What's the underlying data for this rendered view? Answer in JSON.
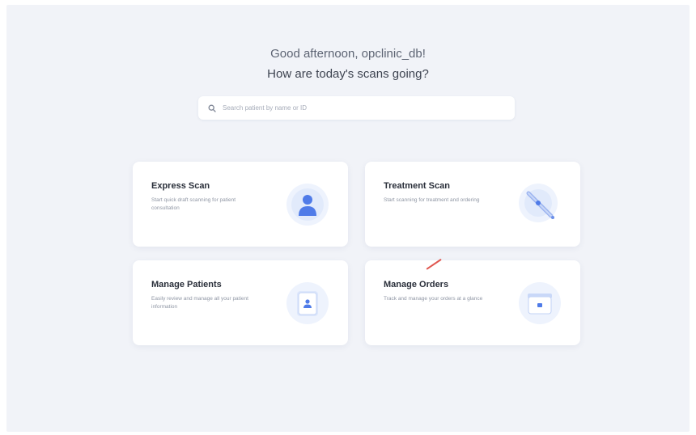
{
  "greeting": {
    "line1": "Good afternoon, opclinic_db!",
    "line2": "How are today's scans going?"
  },
  "search": {
    "placeholder": "Search patient by name or ID",
    "icon": "search-icon"
  },
  "cards": [
    {
      "title": "Express Scan",
      "description": "Start quick draft scanning for patient consultation",
      "icon": "person-icon"
    },
    {
      "title": "Treatment Scan",
      "description": "Start scanning for treatment and ordering",
      "icon": "scanner-icon"
    },
    {
      "title": "Manage Patients",
      "description": "Easily review and manage all your patient information",
      "icon": "patient-file-icon"
    },
    {
      "title": "Manage Orders",
      "description": "Track and manage your orders at a glance",
      "icon": "orders-box-icon"
    }
  ],
  "colors": {
    "background": "#f1f3f8",
    "card": "#ffffff",
    "accent": "#4f7be8",
    "accent_light": "#e3ebfb"
  }
}
